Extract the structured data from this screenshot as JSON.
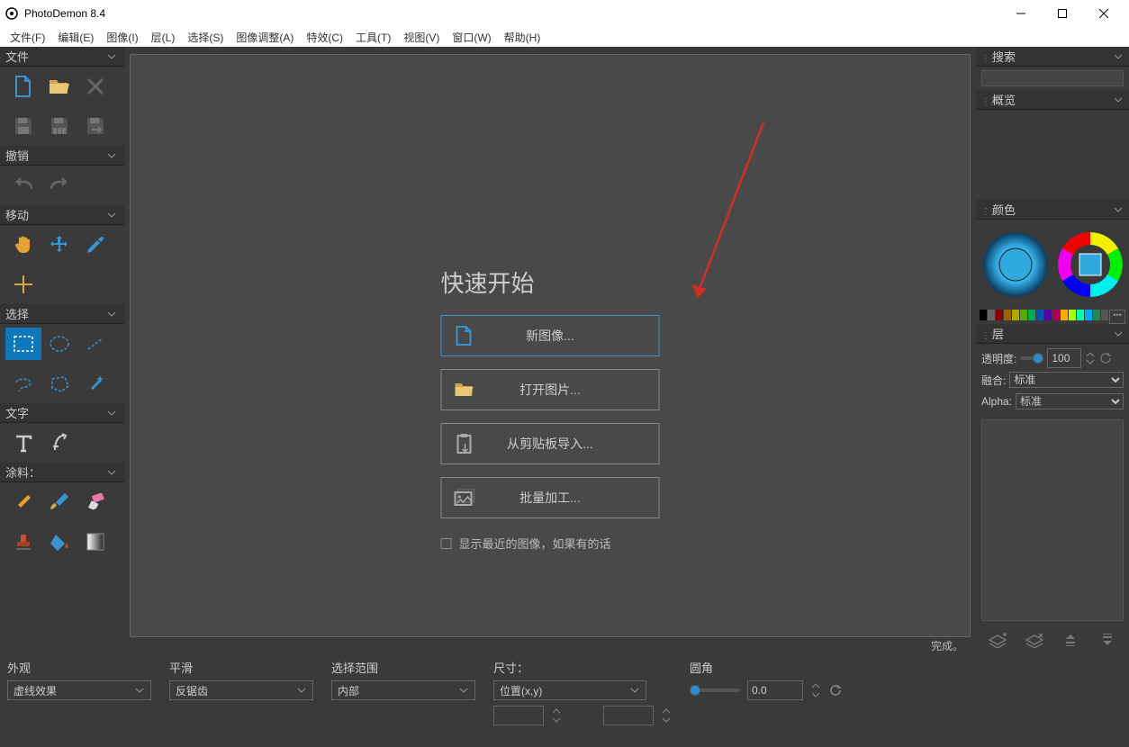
{
  "window": {
    "title": "PhotoDemon 8.4"
  },
  "win_controls": {
    "min": "min",
    "max": "max",
    "close": "close"
  },
  "menubar": [
    "文件(F)",
    "编辑(E)",
    "图像(I)",
    "层(L)",
    "选择(S)",
    "图像调整(A)",
    "特效(C)",
    "工具(T)",
    "视图(V)",
    "窗口(W)",
    "帮助(H)"
  ],
  "toolbox": {
    "sections": {
      "file": {
        "label": "文件"
      },
      "undo": {
        "label": "撤销"
      },
      "move": {
        "label": "移动"
      },
      "select": {
        "label": "选择"
      },
      "text": {
        "label": "文字"
      },
      "paint": {
        "label": "涂料："
      }
    }
  },
  "quickstart": {
    "heading": "快速开始",
    "new_image": "新图像...",
    "open_image": "打开图片...",
    "import_clipboard": "从剪贴板导入...",
    "batch": "批量加工...",
    "show_recent": "显示最近的图像，如果有的话"
  },
  "status": "完成。",
  "right": {
    "search": "搜索",
    "overview": "概览",
    "color": "颜色",
    "layer": "层",
    "opacity_label": "透明度:",
    "opacity_value": "100",
    "blend_label": "融合:",
    "blend_value": "标准",
    "alpha_label": "Alpha:",
    "alpha_value": "标准"
  },
  "swatches": [
    "#000",
    "#555",
    "#800",
    "#808000",
    "#080",
    "#008080",
    "#008",
    "#800080",
    "#fff",
    "#ccc",
    "#f00",
    "#ff0",
    "#0f0",
    "#0ff",
    "#00f",
    "#f0f",
    "#a05020",
    "#40a060",
    "#2060a0",
    "#555"
  ],
  "bottom": {
    "appearance": {
      "label": "外观",
      "value": "虚线效果"
    },
    "smooth": {
      "label": "平滑",
      "value": "反锯齿"
    },
    "range": {
      "label": "选择范围",
      "value": "内部"
    },
    "size": {
      "label": "尺寸：",
      "value": "位置(x,y)"
    },
    "round": {
      "label": "圆角",
      "value": "0.0"
    }
  }
}
